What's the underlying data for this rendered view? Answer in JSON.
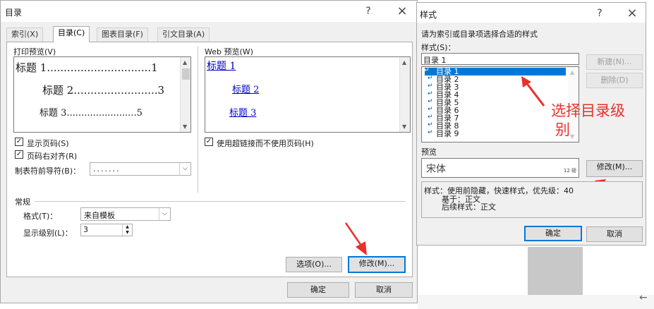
{
  "main": {
    "title": "目录",
    "help": "?",
    "close": "×",
    "tabs": [
      "索引(X)",
      "目录(C)",
      "图表目录(F)",
      "引文目录(A)"
    ],
    "print_preview_label": "打印预览(V)",
    "print_preview_lines": [
      {
        "text": "标题 1",
        "dots": "...............................",
        "page": "1"
      },
      {
        "text": "标题 2",
        "dots": ".........................",
        "page": "3"
      },
      {
        "text": "标题 3",
        "dots": "........................",
        "page": "5"
      }
    ],
    "web_preview_label": "Web 预览(W)",
    "web_links": [
      "标题 1",
      "标题 2",
      "标题 3"
    ],
    "show_page_numbers": "显示页码(S)",
    "right_align": "页码右对齐(R)",
    "leader_label": "制表符前导符(B)：",
    "leader_value": ".......",
    "hyperlinks": "使用超链接而不使用页码(H)",
    "general_label": "常规",
    "format_label": "格式(T)：",
    "format_value": "来自模板",
    "levels_label": "显示级别(L)：",
    "levels_value": "3",
    "options_btn": "选项(O)...",
    "modify_btn": "修改(M)...",
    "ok_btn": "确定",
    "cancel_btn": "取消"
  },
  "style": {
    "title": "样式",
    "help": "?",
    "close": "×",
    "prompt": "请为索引或目录项选择合适的样式",
    "styles_label": "样式(S)：",
    "styles_value": "目录 1",
    "list": [
      "目录 1",
      "目录 2",
      "目录 3",
      "目录 4",
      "目录 5",
      "目录 6",
      "目录 7",
      "目录 8",
      "目录 9"
    ],
    "new_btn": "新建(N)...",
    "delete_btn": "删除(D)",
    "annotation_line1": "选择目录级",
    "annotation_line2": "别",
    "preview_label": "预览",
    "preview_font": "宋体",
    "preview_size": "12 磅",
    "modify_btn": "修改(M)...",
    "desc_line1": "样式：使用前隐藏，快速样式，优先级：40",
    "desc_line2": "基于：正文",
    "desc_line3": "后续样式：正文",
    "ok_btn": "确定",
    "cancel_btn": "取消"
  },
  "colors": {
    "annotation": "#e8312a",
    "accent": "#0078d7"
  },
  "footer_arrow": "←"
}
